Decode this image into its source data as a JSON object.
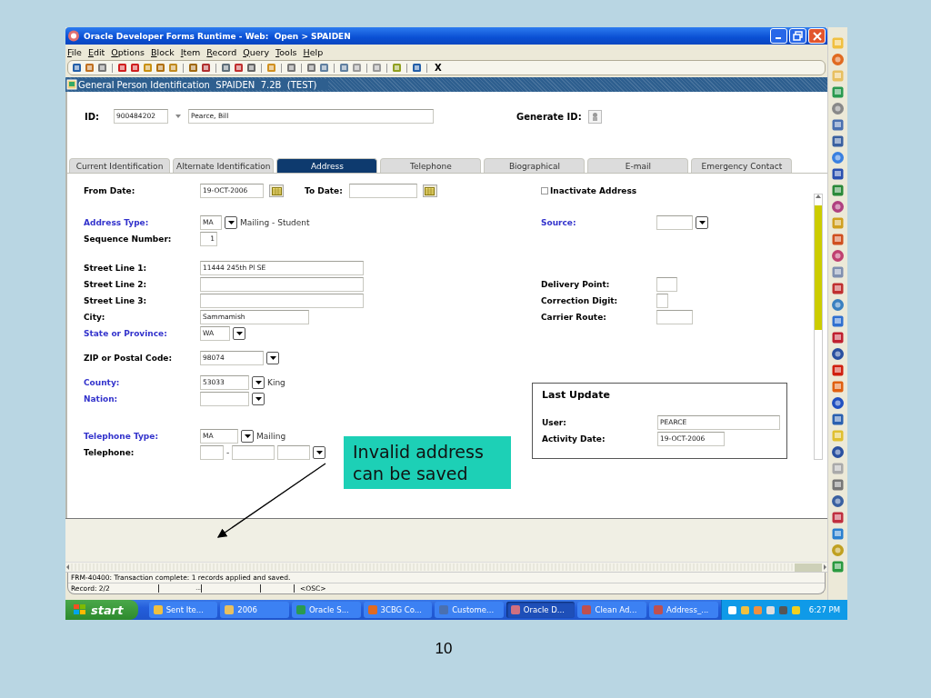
{
  "window": {
    "title": "Oracle Developer Forms Runtime - Web:  Open > SPAIDEN"
  },
  "menu": [
    "File",
    "Edit",
    "Options",
    "Block",
    "Item",
    "Record",
    "Query",
    "Tools",
    "Help"
  ],
  "toolbar": {
    "exit_label": "X"
  },
  "form": {
    "title": "General Person Identification  SPAIDEN  7.2B  (TEST)"
  },
  "key_block": {
    "id_label": "ID:",
    "id": "900484202",
    "name": "Pearce, Bill",
    "generate_label": "Generate ID:"
  },
  "tabs": [
    {
      "label": "Current Identification",
      "selected": false
    },
    {
      "label": "Alternate Identification",
      "selected": false
    },
    {
      "label": "Address",
      "selected": true
    },
    {
      "label": "Telephone",
      "selected": false
    },
    {
      "label": "Biographical",
      "selected": false
    },
    {
      "label": "E-mail",
      "selected": false
    },
    {
      "label": "Emergency Contact",
      "selected": false
    }
  ],
  "address": {
    "left_groups": [
      [
        {
          "label": "From Date:",
          "lookup": false,
          "items": [
            {
              "kind": "date",
              "value": "19-OCT-2006"
            },
            {
              "kind": "calendar"
            },
            {
              "kind": "label",
              "text": "To Date:"
            },
            {
              "kind": "to-date"
            },
            {
              "kind": "calendar"
            }
          ]
        }
      ],
      [
        {
          "label": "Address Type:",
          "lookup": true,
          "items": [
            {
              "kind": "code",
              "value": "MA"
            },
            {
              "kind": "dropdown"
            },
            {
              "kind": "text",
              "text": "Mailing - Student"
            }
          ]
        },
        {
          "label": "Sequence Number:",
          "lookup": false,
          "items": [
            {
              "kind": "seq",
              "value": "1"
            }
          ]
        }
      ],
      [
        {
          "label": "Street Line 1:",
          "lookup": false,
          "items": [
            {
              "kind": "street",
              "value": "11444 245th Pl SE"
            }
          ]
        },
        {
          "label": "Street Line 2:",
          "lookup": false,
          "items": [
            {
              "kind": "street"
            }
          ]
        },
        {
          "label": "Street Line 3:",
          "lookup": false,
          "items": [
            {
              "kind": "street"
            }
          ]
        },
        {
          "label": "City:",
          "lookup": false,
          "items": [
            {
              "kind": "city",
              "value": "Sammamish"
            }
          ]
        },
        {
          "label": "State or Province:",
          "lookup": true,
          "items": [
            {
              "kind": "state",
              "value": "WA"
            },
            {
              "kind": "dropdown"
            }
          ]
        }
      ],
      [
        {
          "label": "ZIP or Postal Code:",
          "lookup": false,
          "items": [
            {
              "kind": "zip",
              "value": "98074"
            },
            {
              "kind": "dropdown"
            }
          ]
        }
      ],
      [
        {
          "label": "County:",
          "lookup": true,
          "items": [
            {
              "kind": "county",
              "value": "53033"
            },
            {
              "kind": "dropdown"
            },
            {
              "kind": "text",
              "text": "King"
            }
          ]
        },
        {
          "label": "Nation:",
          "lookup": true,
          "items": [
            {
              "kind": "county"
            },
            {
              "kind": "dropdown"
            }
          ]
        }
      ],
      [
        {
          "label": "Telephone Type:",
          "lookup": true,
          "items": [
            {
              "kind": "phone-type",
              "value": "MA"
            },
            {
              "kind": "dropdown"
            },
            {
              "kind": "text",
              "text": "Mailing"
            }
          ]
        },
        {
          "label": "Telephone:",
          "lookup": false,
          "items": [
            {
              "kind": "area"
            },
            {
              "kind": "text",
              "text": "-"
            },
            {
              "kind": "phone"
            },
            {
              "kind": "ext"
            },
            {
              "kind": "dropdown"
            }
          ]
        }
      ]
    ],
    "inactivate": {
      "label": "Inactivate Address",
      "checked": false
    },
    "right_groups": [
      [
        {
          "label": "Source:",
          "lookup": true,
          "items": [
            {
              "kind": "source"
            },
            {
              "kind": "dropdown"
            }
          ]
        }
      ],
      [
        {
          "label": "Delivery Point:",
          "lookup": false,
          "items": [
            {
              "kind": "delivery"
            }
          ]
        },
        {
          "label": "Correction Digit:",
          "lookup": false,
          "items": [
            {
              "kind": "digit"
            }
          ]
        },
        {
          "label": "Carrier Route:",
          "lookup": false,
          "items": [
            {
              "kind": "carrier"
            }
          ]
        }
      ]
    ],
    "last_update": {
      "title": "Last Update",
      "rows": [
        {
          "label": "User:",
          "lookup": false,
          "items": [
            {
              "kind": "user",
              "value": "PEARCE"
            }
          ]
        },
        {
          "label": "Activity Date:",
          "lookup": false,
          "items": [
            {
              "kind": "activity",
              "value": "19-OCT-2006"
            }
          ]
        }
      ]
    }
  },
  "status_bar": {
    "message": "FRM-40400: Transaction complete: 1 records applied and saved.",
    "record": "Record: 2/2",
    "ellipsis": "...",
    "mode": "<OSC>"
  },
  "taskbar": {
    "start": "start",
    "items": [
      {
        "label": "Sent Ite...",
        "selected": false
      },
      {
        "label": "2006",
        "selected": false
      },
      {
        "label": "Oracle S...",
        "selected": false
      },
      {
        "label": "3CBG Co...",
        "selected": false
      },
      {
        "label": "Custome...",
        "selected": false
      },
      {
        "label": "Oracle D...",
        "selected": true
      },
      {
        "label": "Clean Ad...",
        "selected": false
      },
      {
        "label": "Address_...",
        "selected": false
      }
    ],
    "clock": "6:27 PM"
  },
  "annotation": {
    "text": "Invalid address can be saved"
  },
  "slide_number": "10"
}
